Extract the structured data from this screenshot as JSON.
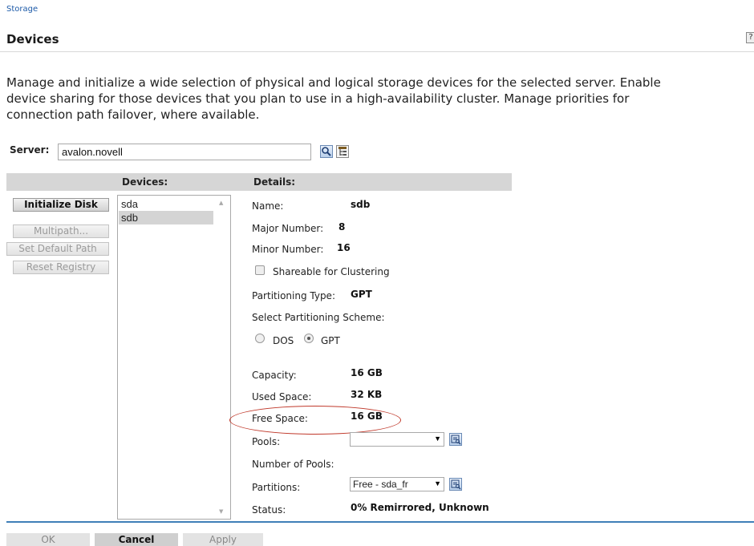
{
  "breadcrumb": "Storage",
  "page_title": "Devices",
  "help_icon": "?",
  "description": "Manage and initialize a wide selection of physical and logical storage devices for the selected server. Enable device sharing for those devices that you plan to use in a high-availability cluster. Manage priorities for connection path failover, where available.",
  "server": {
    "label": "Server:",
    "value": "avalon.novell"
  },
  "columns": {
    "devices": "Devices:",
    "details": "Details:"
  },
  "actions": [
    {
      "label": "Initialize Disk",
      "enabled": true
    },
    {
      "label": "Multipath...",
      "enabled": false
    },
    {
      "label": "Set Default Path",
      "enabled": false
    },
    {
      "label": "Reset Registry",
      "enabled": false
    }
  ],
  "devices": [
    {
      "name": "sda",
      "selected": false
    },
    {
      "name": "sdb",
      "selected": true
    }
  ],
  "details": {
    "name_label": "Name:",
    "name": "sdb",
    "major_label": "Major Number:",
    "major": "8",
    "minor_label": "Minor Number:",
    "minor": "16",
    "shareable_label": "Shareable for Clustering",
    "shareable_checked": false,
    "partitioning_type_label": "Partitioning Type:",
    "partitioning_type": "GPT",
    "scheme_label": "Select Partitioning Scheme:",
    "scheme_options": [
      "DOS",
      "GPT"
    ],
    "scheme_selected": "GPT",
    "capacity_label": "Capacity:",
    "capacity": "16 GB",
    "used_label": "Used Space:",
    "used": "32 KB",
    "free_label": "Free Space:",
    "free": "16 GB",
    "pools_label": "Pools:",
    "pools_value": "",
    "num_pools_label": "Number of Pools:",
    "partitions_label": "Partitions:",
    "partitions_value": "Free - sda_fr",
    "status_label": "Status:",
    "status": "0% Remirrored, Unknown"
  },
  "footer": {
    "ok": "OK",
    "cancel": "Cancel",
    "apply": "Apply"
  },
  "icons": {
    "search": "magnifier-icon",
    "browse": "tree-browse-icon",
    "dropdown": "caret-down-icon"
  },
  "colors": {
    "link": "#1c5aa8",
    "accent_rule": "#3f7fb8",
    "highlight": "#c0392b"
  }
}
